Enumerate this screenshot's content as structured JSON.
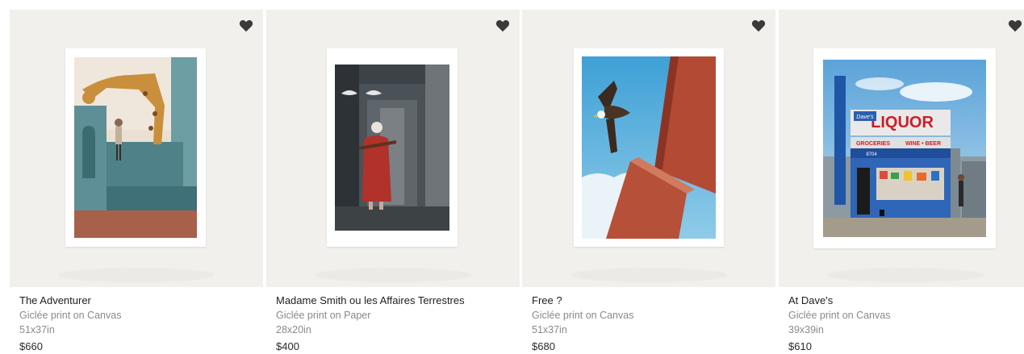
{
  "products": [
    {
      "title": "The Adventurer",
      "medium": "Giclée print on Canvas",
      "size": "51x37in",
      "price": "$660",
      "icon": "heart-icon"
    },
    {
      "title": "Madame Smith ou les Affaires Terrestres",
      "medium": "Giclée print on Paper",
      "size": "28x20in",
      "price": "$400",
      "icon": "heart-icon"
    },
    {
      "title": "Free ?",
      "medium": "Giclée print on Canvas",
      "size": "51x37in",
      "price": "$680",
      "icon": "heart-icon"
    },
    {
      "title": "At Dave's",
      "medium": "Giclée print on Canvas",
      "size": "39x39in",
      "price": "$610",
      "icon": "heart-icon"
    }
  ],
  "colors": {
    "card_bg": "#f2f0ec",
    "heart": "#3a3a3a",
    "title": "#1e1e1e",
    "secondary": "#8a8a8a"
  },
  "artwork_signs": {
    "liquor": "LIQUOR",
    "daves": "Dave's",
    "groceries": "GROCERIES",
    "wine_beer": "WINE • BEER",
    "number": "8704"
  }
}
